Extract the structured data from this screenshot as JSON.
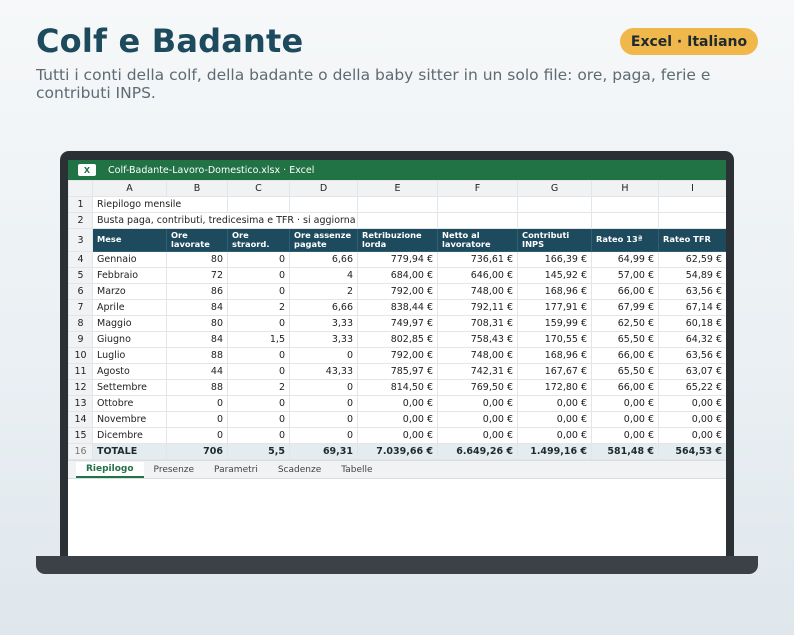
{
  "header": {
    "title": "Colf e Badante",
    "subtitle": "Tutti i conti della colf, della badante o della baby sitter in un solo file: ore, paga, ferie e contributi INPS.",
    "badge": "Excel · Italiano"
  },
  "window": {
    "app_icon": "X",
    "title": "Colf-Badante-Lavoro-Domestico.xlsx · Excel"
  },
  "sheet": {
    "columns": [
      "A",
      "B",
      "C",
      "D",
      "E",
      "F",
      "G",
      "H",
      "I"
    ],
    "row_numbers": [
      "1",
      "2",
      "3",
      "4",
      "5",
      "6",
      "7",
      "8",
      "9",
      "10",
      "11",
      "12",
      "13",
      "14",
      "15",
      "16"
    ],
    "title_row": "Riepilogo mensile",
    "note_row": "Busta paga, contributi, tredicesima e TFR · si aggiorna da solo",
    "headers": [
      "Mese",
      "Ore lavorate",
      "Ore straord.",
      "Ore assenze pagate",
      "Retribuzione lorda",
      "Netto al lavoratore",
      "Contributi INPS",
      "Rateo 13ª",
      "Rateo TFR"
    ],
    "rows": [
      [
        "Gennaio",
        "80",
        "0",
        "6,66",
        "779,94 €",
        "736,61 €",
        "166,39 €",
        "64,99 €",
        "62,59 €"
      ],
      [
        "Febbraio",
        "72",
        "0",
        "4",
        "684,00 €",
        "646,00 €",
        "145,92 €",
        "57,00 €",
        "54,89 €"
      ],
      [
        "Marzo",
        "86",
        "0",
        "2",
        "792,00 €",
        "748,00 €",
        "168,96 €",
        "66,00 €",
        "63,56 €"
      ],
      [
        "Aprile",
        "84",
        "2",
        "6,66",
        "838,44 €",
        "792,11 €",
        "177,91 €",
        "67,99 €",
        "67,14 €"
      ],
      [
        "Maggio",
        "80",
        "0",
        "3,33",
        "749,97 €",
        "708,31 €",
        "159,99 €",
        "62,50 €",
        "60,18 €"
      ],
      [
        "Giugno",
        "84",
        "1,5",
        "3,33",
        "802,85 €",
        "758,43 €",
        "170,55 €",
        "65,50 €",
        "64,32 €"
      ],
      [
        "Luglio",
        "88",
        "0",
        "0",
        "792,00 €",
        "748,00 €",
        "168,96 €",
        "66,00 €",
        "63,56 €"
      ],
      [
        "Agosto",
        "44",
        "0",
        "43,33",
        "785,97 €",
        "742,31 €",
        "167,67 €",
        "65,50 €",
        "63,07 €"
      ],
      [
        "Settembre",
        "88",
        "2",
        "0",
        "814,50 €",
        "769,50 €",
        "172,80 €",
        "66,00 €",
        "65,22 €"
      ],
      [
        "Ottobre",
        "0",
        "0",
        "0",
        "0,00 €",
        "0,00 €",
        "0,00 €",
        "0,00 €",
        "0,00 €"
      ],
      [
        "Novembre",
        "0",
        "0",
        "0",
        "0,00 €",
        "0,00 €",
        "0,00 €",
        "0,00 €",
        "0,00 €"
      ],
      [
        "Dicembre",
        "0",
        "0",
        "0",
        "0,00 €",
        "0,00 €",
        "0,00 €",
        "0,00 €",
        "0,00 €"
      ]
    ],
    "total": [
      "TOTALE",
      "706",
      "5,5",
      "69,31",
      "7.039,66 €",
      "6.649,26 €",
      "1.499,16 €",
      "581,48 €",
      "564,53 €"
    ]
  },
  "tabs": [
    "Riepilogo",
    "Presenze",
    "Parametri",
    "Scadenze",
    "Tabelle"
  ],
  "active_tab": 0
}
